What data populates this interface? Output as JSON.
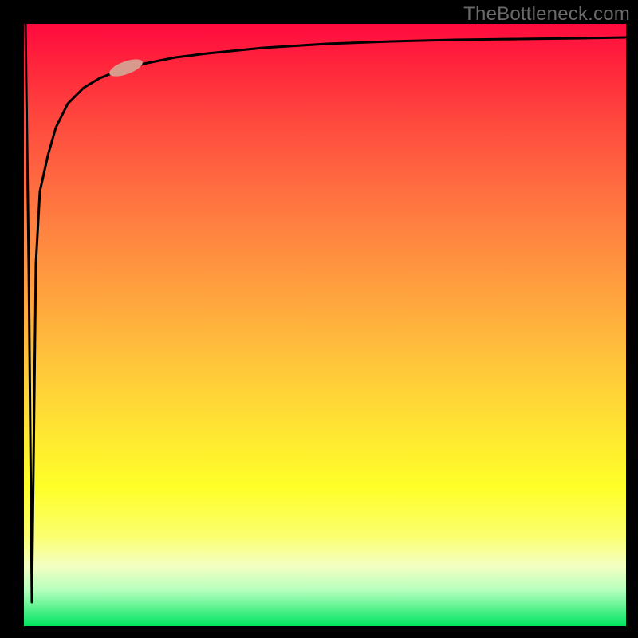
{
  "watermark": {
    "text": "TheBottleneck.com"
  },
  "marker": {
    "fill_hex": "#d79a8c",
    "rx": 22,
    "ry": 8,
    "angle_deg": -20
  },
  "curve_stroke_hex": "#000000",
  "curve_stroke_width": 3,
  "chart_data": {
    "type": "line",
    "title": "",
    "xlabel": "",
    "ylabel": "",
    "xlim": [
      0,
      100
    ],
    "ylim": [
      0,
      100
    ],
    "grid": false,
    "series": [
      {
        "name": "spike",
        "x": [
          0.0,
          0.7,
          1.4,
          2.1
        ],
        "y": [
          100,
          60,
          4,
          60
        ]
      },
      {
        "name": "saturation-curve",
        "x": [
          2.1,
          3,
          4,
          5,
          6,
          8,
          10,
          12,
          15,
          20,
          25,
          30,
          40,
          50,
          60,
          70,
          80,
          90,
          100
        ],
        "y": [
          60,
          72,
          78,
          82,
          85,
          88,
          90,
          91,
          92,
          93.5,
          94.5,
          95.2,
          96,
          96.5,
          96.8,
          97,
          97.2,
          97.4,
          97.5
        ]
      }
    ],
    "annotations": [
      {
        "name": "pill-marker",
        "x": 16.5,
        "y": 92.5,
        "shape": "ellipse"
      }
    ]
  }
}
